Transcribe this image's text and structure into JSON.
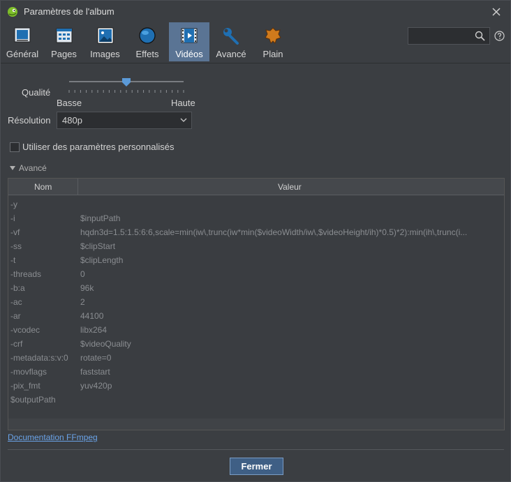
{
  "window": {
    "title": "Paramètres de l'album"
  },
  "tabs": [
    {
      "label": "Général"
    },
    {
      "label": "Pages"
    },
    {
      "label": "Images"
    },
    {
      "label": "Effets"
    },
    {
      "label": "Vidéos",
      "active": true
    },
    {
      "label": "Avancé"
    },
    {
      "label": "Plain"
    }
  ],
  "search": {
    "value": "",
    "placeholder": ""
  },
  "video": {
    "quality_label": "Qualité",
    "quality_low": "Basse",
    "quality_high": "Haute",
    "quality_level": 0.5,
    "resolution_label": "Résolution",
    "resolution_value": "480p",
    "custom_params_label": "Utiliser des paramètres personnalisés",
    "custom_params_checked": false,
    "advanced_label": "Avancé"
  },
  "table": {
    "col_name": "Nom",
    "col_value": "Valeur",
    "rows": [
      {
        "name": "-y",
        "value": ""
      },
      {
        "name": "-i",
        "value": "$inputPath"
      },
      {
        "name": "-vf",
        "value": "hqdn3d=1.5:1.5:6:6,scale=min(iw\\,trunc(iw*min($videoWidth/iw\\,$videoHeight/ih)*0.5)*2):min(ih\\,trunc(i..."
      },
      {
        "name": "-ss",
        "value": "$clipStart"
      },
      {
        "name": "-t",
        "value": "$clipLength"
      },
      {
        "name": "-threads",
        "value": "0"
      },
      {
        "name": "-b:a",
        "value": "96k"
      },
      {
        "name": "-ac",
        "value": "2"
      },
      {
        "name": "-ar",
        "value": "44100"
      },
      {
        "name": "-vcodec",
        "value": "libx264"
      },
      {
        "name": "-crf",
        "value": "$videoQuality"
      },
      {
        "name": "-metadata:s:v:0",
        "value": "rotate=0"
      },
      {
        "name": "-movflags",
        "value": "faststart"
      },
      {
        "name": "-pix_fmt",
        "value": "yuv420p"
      },
      {
        "name": "$outputPath",
        "value": ""
      }
    ]
  },
  "doc_link": "Documentation FFmpeg",
  "close_button": "Fermer",
  "colors": {
    "accent_tab": "#5a7494",
    "link": "#6aa3e8",
    "button": "#3f5f85"
  }
}
